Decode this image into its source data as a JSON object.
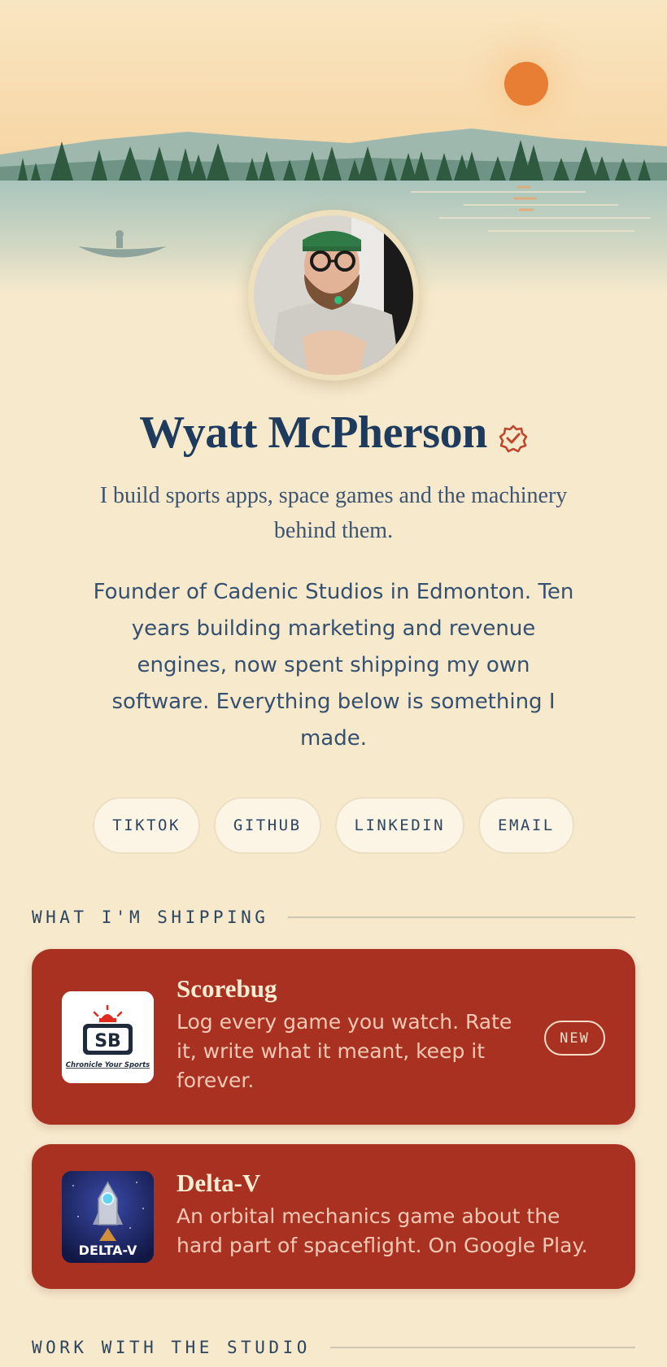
{
  "profile": {
    "name": "Wyatt McPherson",
    "tagline": "I build sports apps, space games and the machinery behind them.",
    "bio": "Founder of Cadenic Studios in Edmonton. Ten years building marketing and revenue engines, now spent shipping my own software. Everything below is something I made."
  },
  "socials": [
    "TIKTOK",
    "GITHUB",
    "LINKEDIN",
    "EMAIL"
  ],
  "sections": {
    "shipping": "WHAT I'M SHIPPING",
    "studio": "WORK WITH THE STUDIO"
  },
  "projects": [
    {
      "title": "Scorebug",
      "description": "Log every game you watch. Rate it, write what it meant, keep it forever.",
      "badge": "NEW",
      "logo_text": "SB",
      "logo_caption": "Chronicle Your Sports"
    },
    {
      "title": "Delta-V",
      "description": "An orbital mechanics game about the hard part of spaceflight. On Google Play.",
      "logo_text": "DELTA-V"
    }
  ],
  "colors": {
    "background": "#f6e9cc",
    "card": "#a83121",
    "heading": "#1e3a5c",
    "sun": "#e87e34",
    "verified": "#c0452c"
  },
  "icons": {
    "verified": "verified-badge-icon"
  }
}
